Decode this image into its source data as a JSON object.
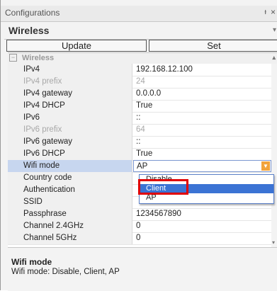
{
  "window": {
    "title": "Configurations",
    "pin_icon": "pin-icon",
    "close_icon": "close-icon",
    "close_glyph": "×",
    "pin_glyph": "ᵼ"
  },
  "selector": {
    "value": "Wireless"
  },
  "buttons": {
    "update": "Update",
    "set": "Set"
  },
  "category": {
    "label": "Wireless",
    "collapse_glyph": "−"
  },
  "properties": [
    {
      "name": "IPv4",
      "value": "192.168.12.100",
      "disabled": false
    },
    {
      "name": "IPv4 prefix",
      "value": "24",
      "disabled": true
    },
    {
      "name": "IPv4 gateway",
      "value": "0.0.0.0",
      "disabled": false
    },
    {
      "name": "IPv4 DHCP",
      "value": "True",
      "disabled": false
    },
    {
      "name": "IPv6",
      "value": "::",
      "disabled": false
    },
    {
      "name": "IPv6 prefix",
      "value": "64",
      "disabled": true
    },
    {
      "name": "IPv6 gateway",
      "value": "::",
      "disabled": false
    },
    {
      "name": "IPv6 DHCP",
      "value": "True",
      "disabled": false
    },
    {
      "name": "Wifi mode",
      "value": "AP",
      "disabled": false,
      "selected": true
    },
    {
      "name": "Country code",
      "value": "",
      "disabled": false
    },
    {
      "name": "Authentication",
      "value": "",
      "disabled": false
    },
    {
      "name": "SSID",
      "value": "",
      "disabled": false
    },
    {
      "name": "Passphrase",
      "value": "1234567890",
      "disabled": false
    },
    {
      "name": "Channel 2.4GHz",
      "value": "0",
      "disabled": false
    },
    {
      "name": "Channel 5GHz",
      "value": "0",
      "disabled": false
    }
  ],
  "dropdown": {
    "options": [
      "Disable",
      "Client",
      "AP"
    ],
    "selected": "Client"
  },
  "description": {
    "title": "Wifi mode",
    "text": "Wifi mode: Disable, Client, AP"
  },
  "colors": {
    "selection": "#3b73d4",
    "highlight_box": "#e00000",
    "dropdown_button": "#f2a33b"
  }
}
